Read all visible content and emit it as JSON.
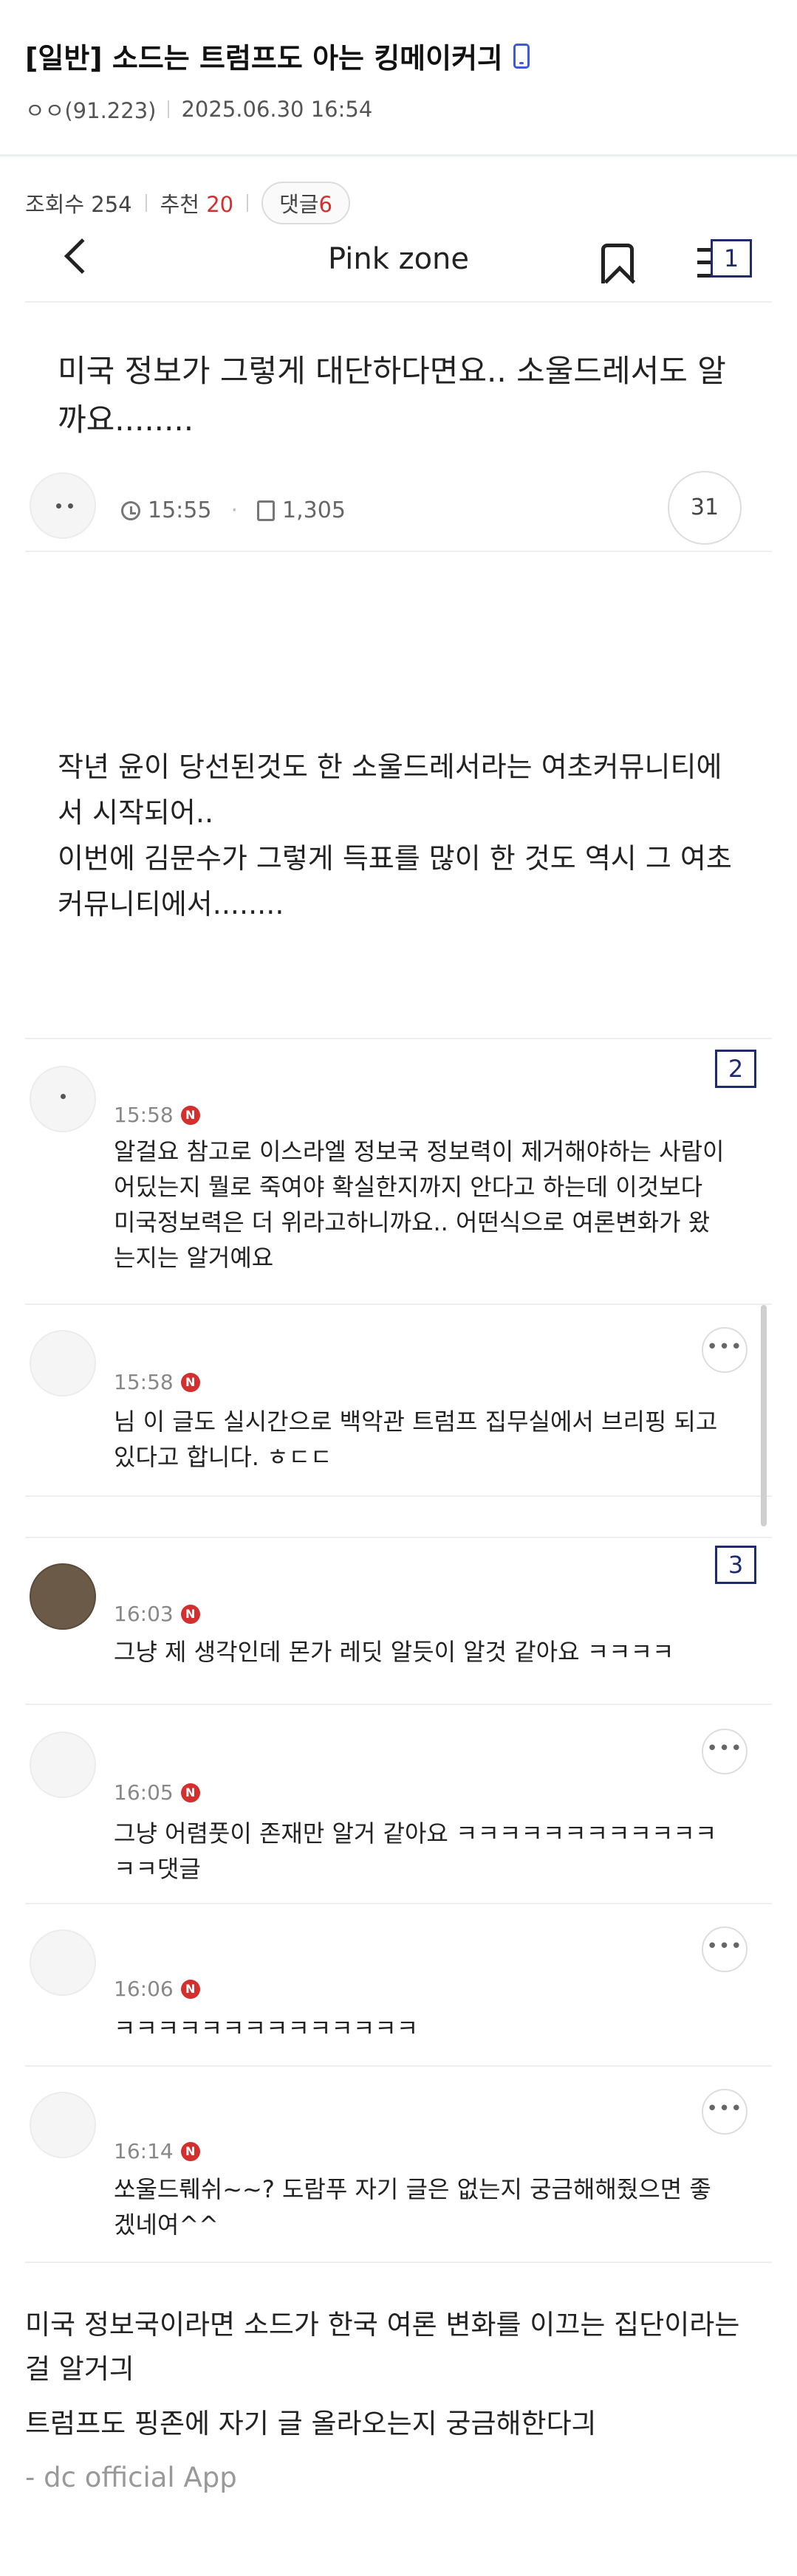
{
  "post": {
    "title": "[일반] 소드는 트럼프도 아는 킹메이커긔",
    "author": "ㅇㅇ(91.223)",
    "datetime": "2025.06.30 16:54",
    "views_label": "조회수 254",
    "recommend_label": "추천",
    "recommend_count": "20",
    "reply_label": "댓글",
    "reply_count": "6"
  },
  "app": {
    "nav_title": "Pink zone",
    "badges": [
      "1",
      "2",
      "3"
    ],
    "article_title": "미국 정보가 그렇게 대단하다면요.. 소울드레서도 알까요........",
    "article_time": "15:55",
    "article_views": "1,305",
    "comment_count": "31",
    "body_lines": [
      "작년 윤이 당선된것도 한 소울드레서라는 여초커뮤니티에",
      "서 시작되어..",
      "이번에 김문수가 그렇게 득표를 많이 한 것도 역시 그 여초",
      "커뮤니티에서........"
    ],
    "comments": [
      {
        "time": "15:58",
        "text": "알걸요 참고로 이스라엘 정보국 정보력이 제거해야하는 사람이 어딨는지 뭘로 죽여야 확실한지까지 안다고 하는데 이것보다 미국정보력은 더 위라고하니까요.. 어떤식으로 여론변화가 왔는지는 알거예요"
      },
      {
        "time": "15:58",
        "text": "님 이 글도 실시간으로 백악관 트럼프 집무실에서 브리핑 되고 있다고 합니다. ㅎㄷㄷ"
      },
      {
        "time": "16:03",
        "text": "그냥 제 생각인데 몬가 레딧 알듯이 알것 같아요 ㅋㅋㅋㅋ"
      },
      {
        "time": "16:05",
        "text": "그냥 어렴풋이 존재만 알거 같아요 ㅋㅋㅋㅋㅋㅋㅋㅋㅋㅋㅋㅋㅋㅋ댓글"
      },
      {
        "time": "16:06",
        "text": "ㅋㅋㅋㅋㅋㅋㅋㅋㅋㅋㅋㅋㅋㅋ"
      },
      {
        "time": "16:14",
        "text": "쏘울드뤠쉬~~? 도람푸 자기 글은 없는지 궁금해해줬으면 좋겠네여^^"
      }
    ],
    "n_badge": "N",
    "more_label": "•••"
  },
  "footer": {
    "lines": [
      "미국 정보국이라면 소드가 한국 여론 변화를 이끄는 집단이라는 걸 알거긔",
      "트럼프도 핑존에 자기 글 올라오는지 궁금해한다긔"
    ],
    "app_tag": "- dc official App"
  }
}
